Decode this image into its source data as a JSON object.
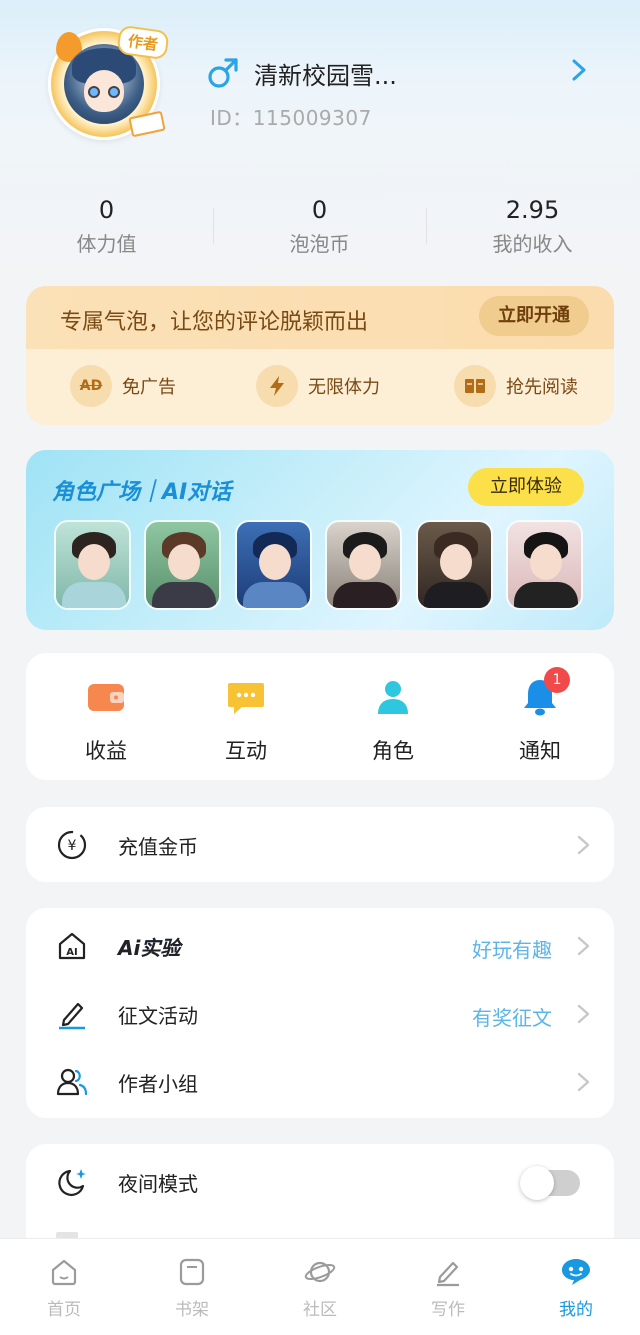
{
  "profile": {
    "author_badge": "作者",
    "gender": "male",
    "username": "清新校园雪...",
    "user_id": "ID：115009307"
  },
  "stats": [
    {
      "value": "0",
      "label": "体力值"
    },
    {
      "value": "0",
      "label": "泡泡币"
    },
    {
      "value": "2.95",
      "label": "我的收入"
    }
  ],
  "vip": {
    "title": "专属气泡，让您的评论脱颖而出",
    "button": "立即开通",
    "perks": [
      {
        "icon": "AD",
        "label": "免广告"
      },
      {
        "icon": "lightning-icon",
        "label": "无限体力"
      },
      {
        "icon": "book-icon",
        "label": "抢先阅读"
      }
    ]
  },
  "role_plaza": {
    "title": "角色广场｜AI对话",
    "button": "立即体验",
    "characters": 6
  },
  "quick_actions": [
    {
      "label": "收益",
      "icon": "wallet-icon",
      "color": "#f5874f"
    },
    {
      "label": "互动",
      "icon": "chat-icon",
      "color": "#f7c234"
    },
    {
      "label": "角色",
      "icon": "person-icon",
      "color": "#2ec7e0"
    },
    {
      "label": "通知",
      "icon": "bell-icon",
      "color": "#1b8fe8",
      "badge": "1"
    }
  ],
  "recharge": {
    "label": "充值金币"
  },
  "menu": [
    {
      "label": "Ai实验",
      "extra": "好玩有趣"
    },
    {
      "label": "征文活动",
      "extra": "有奖征文"
    },
    {
      "label": "作者小组",
      "extra": ""
    }
  ],
  "settings": [
    {
      "label": "夜间模式",
      "toggle": false
    }
  ],
  "tabs": [
    {
      "label": "首页",
      "active": false
    },
    {
      "label": "书架",
      "active": false
    },
    {
      "label": "社区",
      "active": false
    },
    {
      "label": "写作",
      "active": false
    },
    {
      "label": "我的",
      "active": true
    }
  ],
  "colors": {
    "accent": "#1a98e0",
    "vip_text": "#7a4a14",
    "link": "#5bb5e8"
  }
}
